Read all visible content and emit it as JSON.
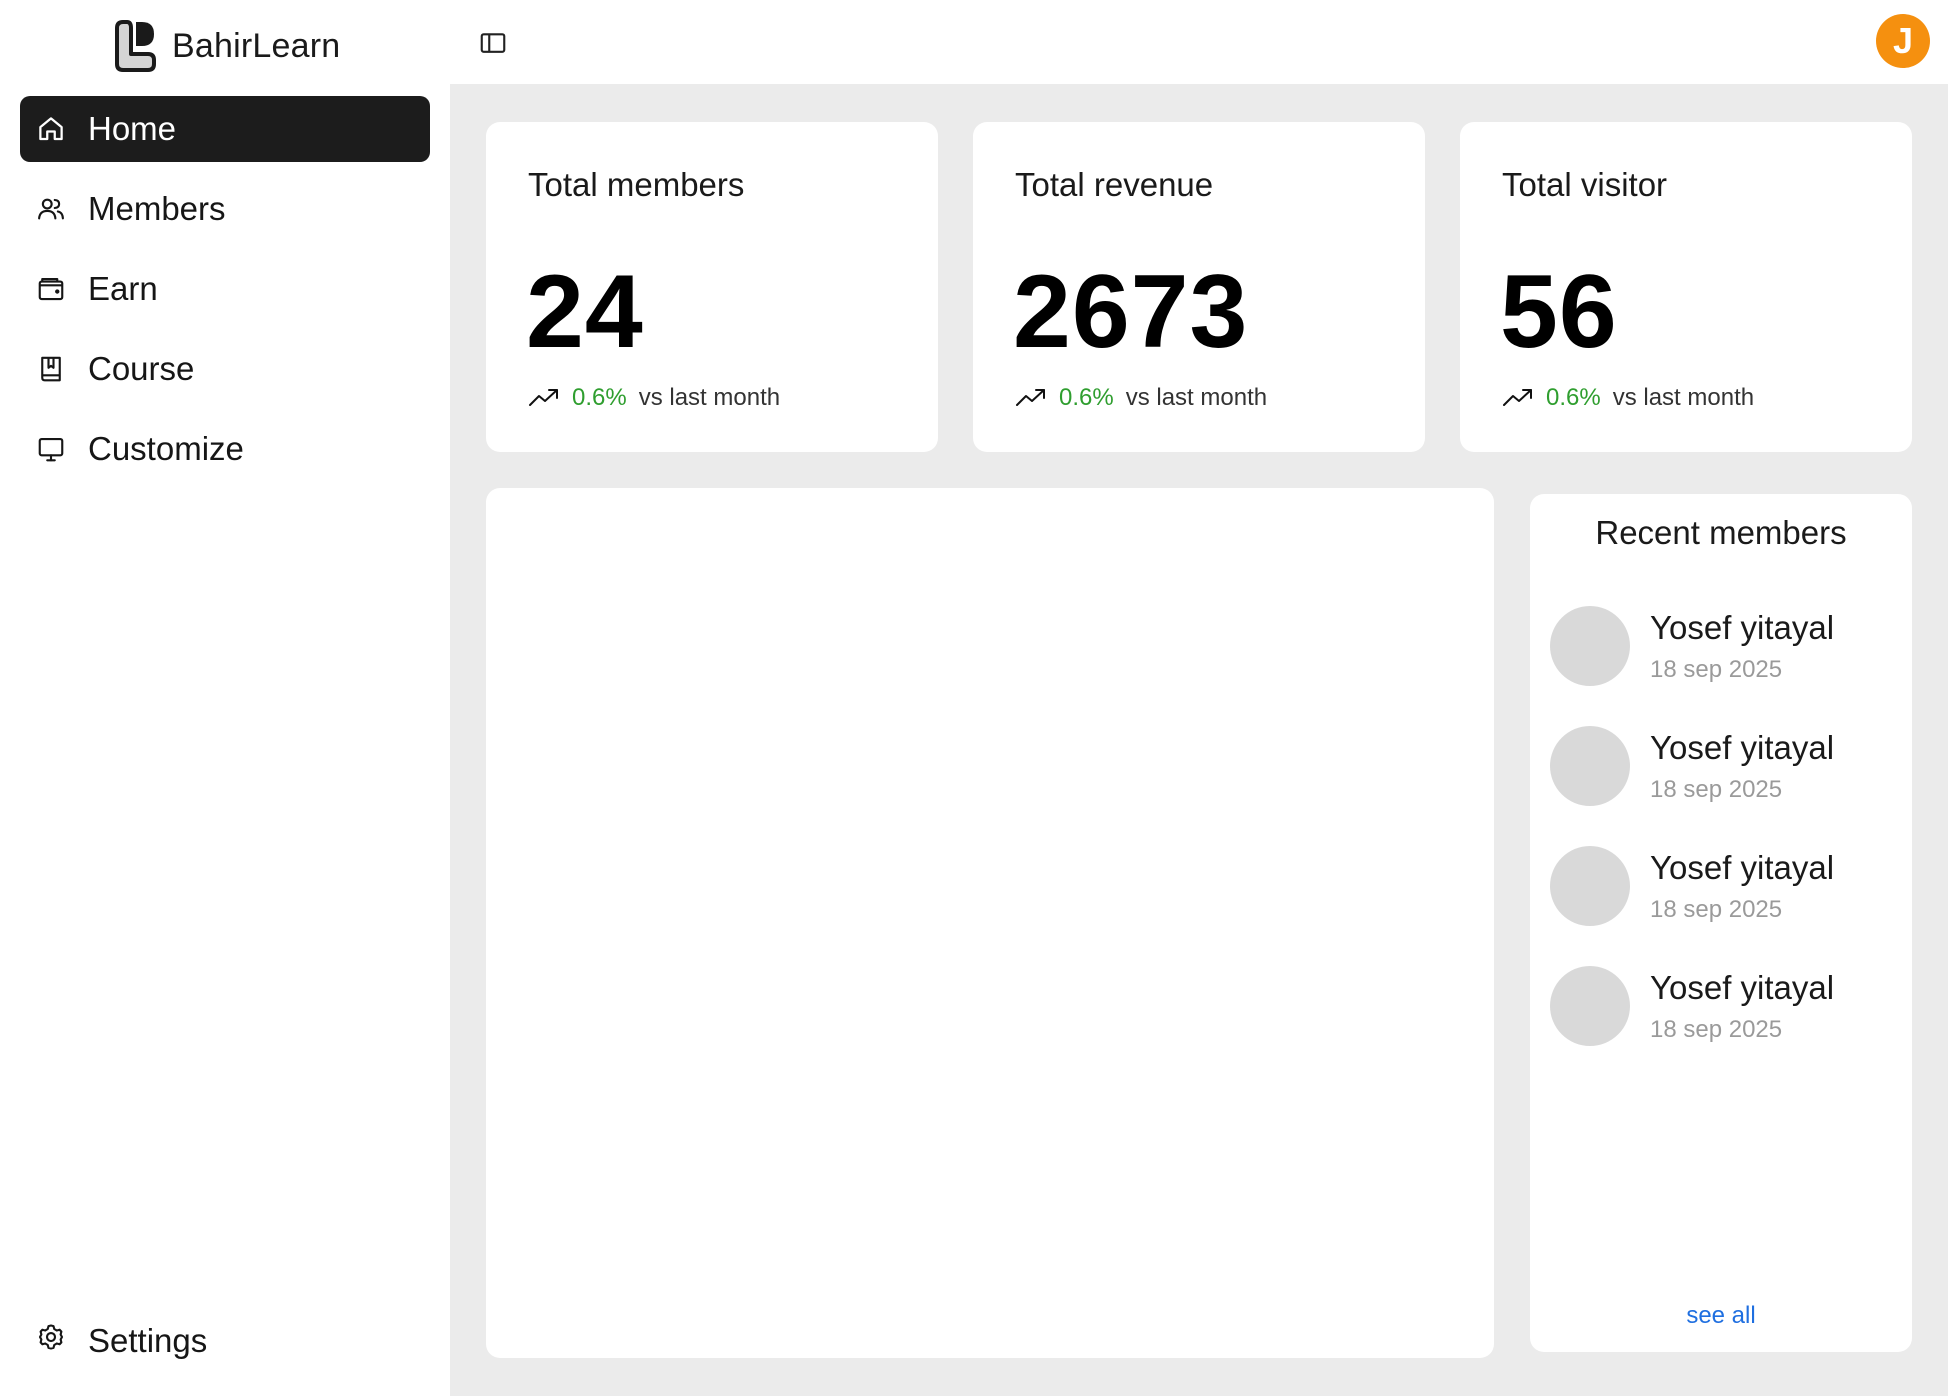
{
  "brand": {
    "name": "BahirLearn",
    "icon": "bahirlearn-logo"
  },
  "sidebar": {
    "items": [
      {
        "label": "Home",
        "icon": "home-icon",
        "active": true
      },
      {
        "label": "Members",
        "icon": "users-icon",
        "active": false
      },
      {
        "label": "Earn",
        "icon": "wallet-icon",
        "active": false
      },
      {
        "label": "Course",
        "icon": "book-icon",
        "active": false
      },
      {
        "label": "Customize",
        "icon": "monitor-icon",
        "active": false
      }
    ],
    "settings": {
      "label": "Settings",
      "icon": "gear-icon"
    }
  },
  "topbar": {
    "toggle_icon": "sidebar-toggle-icon",
    "user_initial": "J",
    "user_avatar_color": "#f5900f"
  },
  "stats": [
    {
      "title": "Total members",
      "value": "24",
      "change": "0.6%",
      "suffix": "vs last month"
    },
    {
      "title": "Total revenue",
      "value": "2673",
      "change": "0.6%",
      "suffix": "vs last month"
    },
    {
      "title": "Total visitor",
      "value": "56",
      "change": "0.6%",
      "suffix": "vs last month"
    }
  ],
  "recent": {
    "title": "Recent members",
    "members": [
      {
        "name": "Yosef yitayal",
        "date": "18 sep 2025"
      },
      {
        "name": "Yosef yitayal",
        "date": "18 sep 2025"
      },
      {
        "name": "Yosef yitayal",
        "date": "18 sep 2025"
      },
      {
        "name": "Yosef yitayal",
        "date": "18 sep 2025"
      }
    ],
    "see_all": "see all"
  },
  "colors": {
    "accent_dark": "#1c1c1c",
    "trend_green": "#2f9e2f",
    "link_blue": "#1f6fe0",
    "background": "#ebebeb"
  }
}
